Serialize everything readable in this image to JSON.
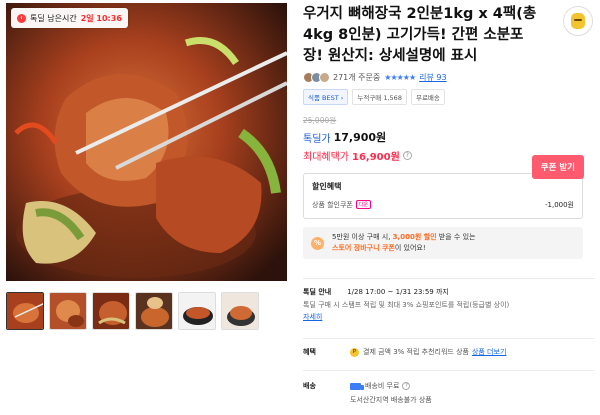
{
  "deal_badge": {
    "label": "톡딜 남은시간",
    "time": "2일 10:36"
  },
  "product": {
    "title": "우거지 뼈해장국 2인분1kg x 4팩(총 4kg 8인분) 고기가득! 간편 소분포장! 원산지: 상세설명에 표시"
  },
  "rating": {
    "orders": "271개 주문중",
    "stars": "★★★★★",
    "review_link": "리뷰 93"
  },
  "chips": [
    "식품 BEST ›",
    "누적구매 1,568",
    "무료배송"
  ],
  "pricing": {
    "original": "25,000원",
    "talkdeal_label": "톡딜가",
    "talkdeal_price": "17,900원",
    "max_label": "최대혜택가",
    "max_price": "16,900원",
    "help": "?",
    "coupon_button": "쿠폰 받기"
  },
  "discount": {
    "heading": "할인혜택",
    "line_label": "상품 할인쿠폰",
    "line_tag": "다운",
    "line_amount": "-1,000원"
  },
  "promo": {
    "icon": "%",
    "line1_pre": "5만원 이상 구매 시, ",
    "line1_hl": "3,000원 할인",
    "line1_post": " 받을 수 있는",
    "line2_hl": "스토어 장바구니 쿠폰",
    "line2_post": "이 있어요!"
  },
  "deal_info": {
    "key": "톡딜 안내",
    "period": "1/28 17:00 ~ 1/31 23:59 까지",
    "desc": "톡딜 구매 시 스탬프 적립 및 최대 3% 쇼핑포인트를 적립(등급별 상이)",
    "more": "자세히"
  },
  "benefit": {
    "key": "혜택",
    "icon": "P",
    "text": "결제 금액 3% 적립 추천리워드 상품",
    "link": "상품 더보기"
  },
  "shipping": {
    "key": "배송",
    "line1": "배송비 무료",
    "help": "?",
    "line2": "도서산간지역 배송불가 상품"
  },
  "colors": {
    "accent_blue": "#1a5dd6",
    "accent_red": "#ff2b4a",
    "coupon_btn": "#ff5a6e"
  },
  "icons": [
    "clock-icon",
    "mascot-icon",
    "percent-icon",
    "coin-icon",
    "truck-icon",
    "help-icon"
  ]
}
